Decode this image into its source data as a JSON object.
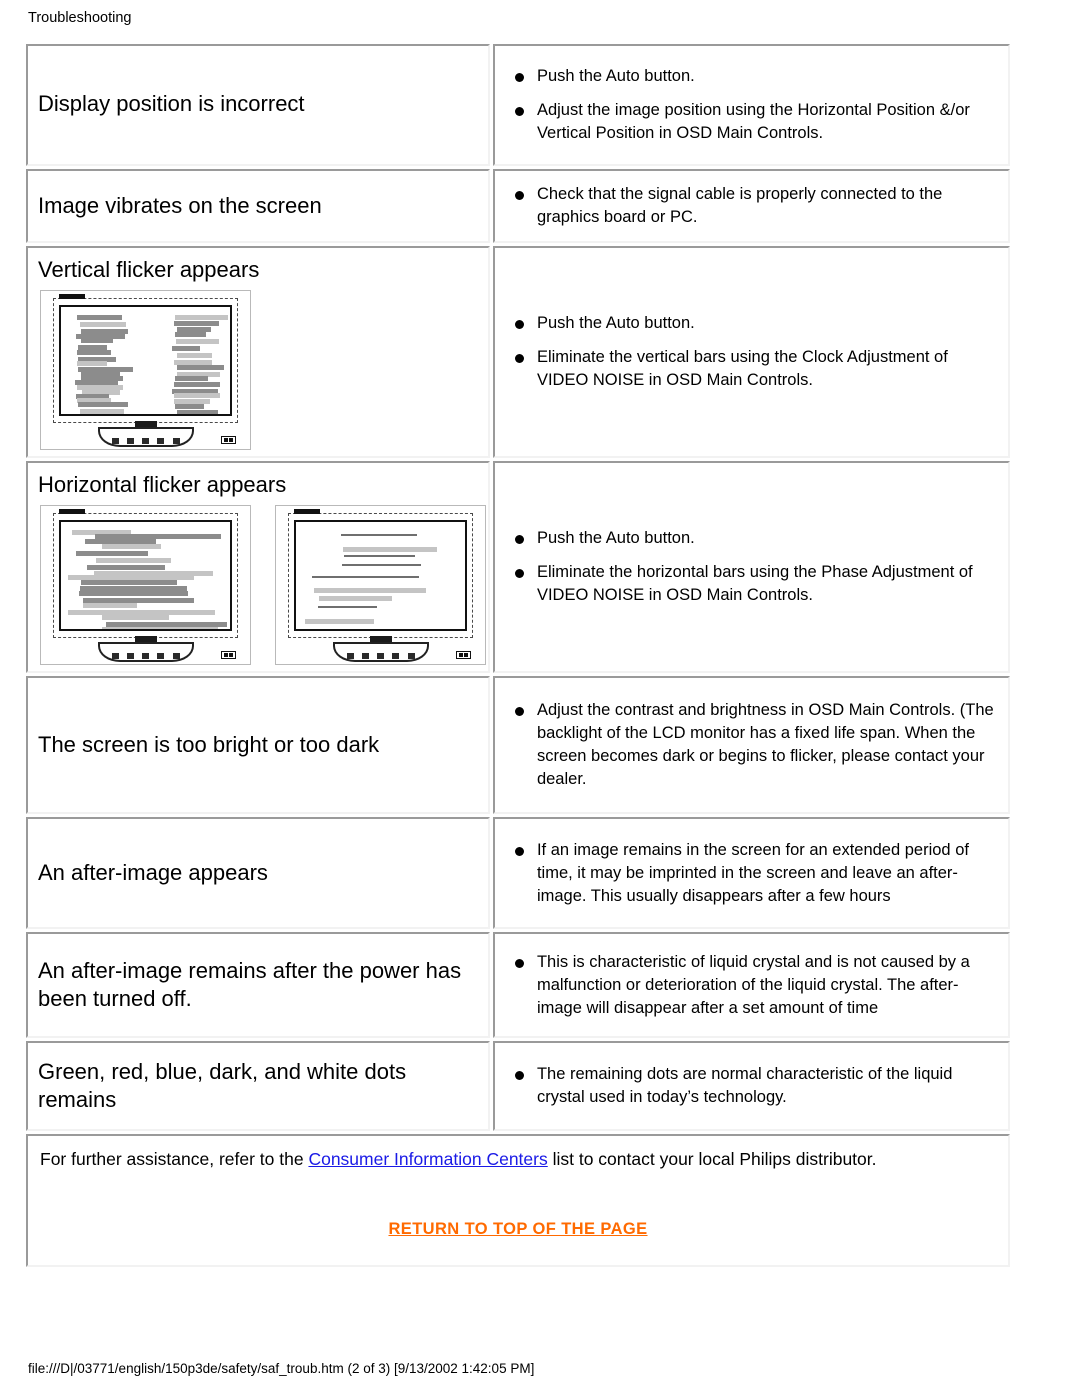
{
  "page": {
    "title": "Troubleshooting",
    "footer_path": "file:///D|/03771/english/150p3de/safety/saf_troub.htm (2 of 3) [9/13/2002 1:42:05 PM]"
  },
  "colors": {
    "link": "#1a1ae6",
    "return_link": "#ff6a00",
    "cell_border_dark": "#9a9a9a",
    "cell_border_light": "#f2f2f2",
    "inner_border": "#4d4d4d",
    "bar_dark": "#8c8c8c",
    "bar_light": "#c4c4c4"
  },
  "rows": [
    {
      "symptom": "Display position is incorrect",
      "has_image": false,
      "notes": [
        "Push the Auto button.",
        "Adjust the image position using the Horizontal Position &/or Vertical Position in OSD Main Controls."
      ]
    },
    {
      "symptom": "Image vibrates on the screen",
      "has_image": false,
      "notes": [
        "Check that the signal cable is properly connected to the graphics board or PC."
      ]
    },
    {
      "symptom": "Vertical flicker appears",
      "has_image": true,
      "image_count": 1,
      "image_name": "vertical-flicker-monitor-illustration",
      "notes": [
        "Push the Auto button.",
        "Eliminate the vertical bars using the Clock Adjustment of VIDEO NOISE in OSD Main Controls."
      ]
    },
    {
      "symptom": "Horizontal flicker appears",
      "has_image": true,
      "image_count": 2,
      "image_name": "horizontal-flicker-monitor-illustration",
      "notes": [
        "Push the Auto button.",
        "Eliminate the horizontal bars using the Phase Adjustment of VIDEO NOISE in OSD Main Controls."
      ]
    },
    {
      "symptom": "The screen is too bright or too dark",
      "has_image": false,
      "notes": [
        "Adjust the contrast and brightness in OSD Main Controls. (The backlight of the LCD monitor has a fixed life span. When the screen becomes dark or begins to flicker, please contact your dealer."
      ]
    },
    {
      "symptom": "An after-image appears",
      "has_image": false,
      "notes": [
        "If an image remains in the screen for an extended period of time, it may be imprinted in the screen and leave an after-image. This usually disappears after a few hours"
      ]
    },
    {
      "symptom": "An after-image remains after the power has been turned off.",
      "has_image": false,
      "notes": [
        "This is characteristic of liquid crystal and is not caused by a malfunction or deterioration of the liquid crystal. The after-image will disappear after a set amount of time"
      ]
    },
    {
      "symptom": "Green, red, blue, dark, and white dots remains",
      "has_image": false,
      "notes": [
        "The remaining dots are normal characteristic of the liquid crystal used in today’s technology."
      ]
    }
  ],
  "assistance": {
    "before_link": "For further assistance, refer to the ",
    "link_text": "Consumer Information Centers",
    "after_link": " list to contact your local Philips distributor.",
    "return_link": "RETURN TO TOP OF THE PAGE"
  }
}
